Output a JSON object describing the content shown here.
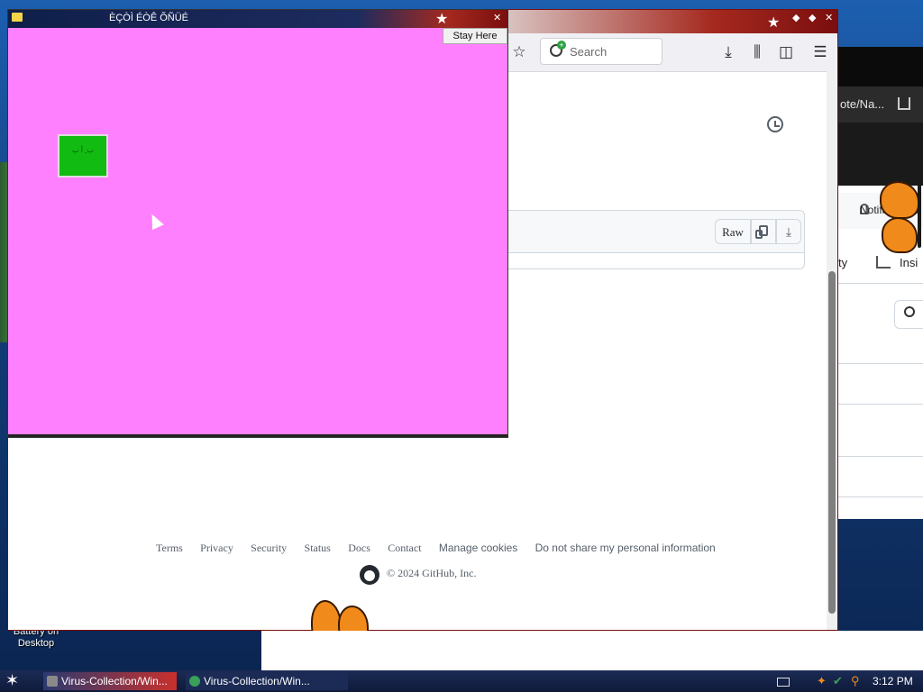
{
  "desktop": {
    "shortcut_label": "Battery on Desktop"
  },
  "right_window": {
    "address_fragment": "ote/Na...",
    "notifications_label": "Notifications",
    "tab_activity_fragment": "ty",
    "tab_insights_fragment": "Insi"
  },
  "firefox": {
    "search_placeholder": "Search",
    "toolbar_icons": [
      "bookmark-star-icon",
      "download-icon",
      "library-icon",
      "sidebar-icon",
      "menu-icon"
    ],
    "file_actions": {
      "raw_label": "Raw"
    },
    "footer": {
      "links": [
        "Terms",
        "Privacy",
        "Security",
        "Status",
        "Docs",
        "Contact",
        "Manage cookies",
        "Do not share my personal information"
      ],
      "copyright": "© 2024 GitHub, Inc."
    }
  },
  "prank_window": {
    "title": "ÈÇÒÌ ÉÒÊ ÕÑÜÉ",
    "stay_button": "Stay Here",
    "green_box_text": "ب ِ أ ب"
  },
  "taskbar": {
    "tasks": [
      {
        "label": "Virus-Collection/Win..."
      },
      {
        "label": "Virus-Collection/Win..."
      }
    ],
    "clock": "3:12 PM"
  },
  "colors": {
    "prank_background": "#ff80ff",
    "green_box": "#11bb11",
    "title_bar_red": "#7a0e0e"
  }
}
